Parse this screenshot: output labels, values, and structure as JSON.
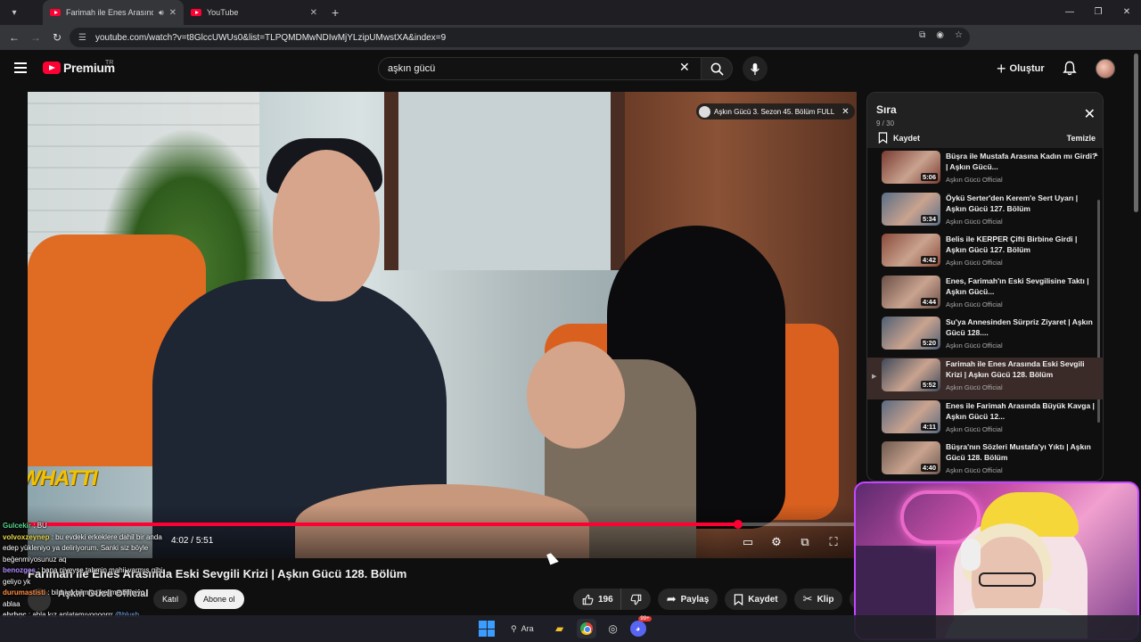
{
  "browser": {
    "tabs": [
      {
        "title": "Farimah ile Enes Arasında E",
        "active": true
      },
      {
        "title": "YouTube",
        "active": false
      }
    ],
    "url": "youtube.com/watch?v=t8GlccUWUs0&list=TLPQMDMwNDIwMjYLzipUMwstXA&index=9"
  },
  "header": {
    "logo": "Premium",
    "region": "TR",
    "search_query": "aşkın gücü",
    "create_label": "Oluştur"
  },
  "player": {
    "chip_label": "Aşkın Gücü 3. Sezon 45. Bölüm FULL",
    "time_current": "4:02",
    "time_total": "5:51",
    "progress": 0.857,
    "channel_logo_text": "WHATTI"
  },
  "video": {
    "title": "Farimah ile Enes Arasında Eski Sevgili Krizi | Aşkın Gücü 128. Bölüm",
    "channel": "Aşkın Gücü Official",
    "join_label": "Katıl",
    "subscribe_label": "Abone ol",
    "likes": "196",
    "share_label": "Paylaş",
    "save_label": "Kaydet",
    "clip_label": "Klip"
  },
  "chat": [
    {
      "user": "Gulcekir",
      "color": "green",
      "text": "BU"
    },
    {
      "user": "volvoxzeynep",
      "color": "yellow",
      "text": "bu evdeki erkeklere dahil bir anda"
    },
    {
      "user": "",
      "color": "white",
      "text": "edep yükleniyo ya deliriyorum. Sanki siz böyle"
    },
    {
      "user": "",
      "color": "white",
      "text": "beğenmiyosunuz aq"
    },
    {
      "user": "benozges",
      "color": "purple",
      "text": "bana niyeyse tahmin mahii varmış gibi"
    },
    {
      "user": "",
      "color": "white",
      "text": "geliyo yk"
    },
    {
      "user": "durumastisti",
      "color": "orange",
      "text": "bilmiyo bilmiyo kelime bilmiyo"
    },
    {
      "user": "",
      "color": "white",
      "text": "ablaa"
    },
    {
      "user": "ebrbgc",
      "color": "white",
      "text": "abla kız anlatamıyoooorrr",
      "mention": "@blush"
    }
  ],
  "queue": {
    "title": "Sıra",
    "count": "9 / 30",
    "save_label": "Kaydet",
    "clear_label": "Temizle",
    "items": [
      {
        "title": "Büşra ile Mustafa Arasına Kadın mı Girdi? | Aşkın Gücü...",
        "channel": "Aşkın Gücü Official",
        "duration": "5:06",
        "thumb_color": "#7a3b32",
        "active": false
      },
      {
        "title": "Öykü Serter'den Kerem'e Sert Uyarı | Aşkın Gücü 127. Bölüm",
        "channel": "Aşkın Gücü Official",
        "duration": "5:34",
        "thumb_color": "#5a6e86",
        "active": false
      },
      {
        "title": "Belis ile KERPER Çifti Birbine Girdi | Aşkın Gücü 127. Bölüm",
        "channel": "Aşkın Gücü Official",
        "duration": "4:42",
        "thumb_color": "#8a4a3a",
        "active": false
      },
      {
        "title": "Enes, Farimah'ın Eski Sevgilisine Taktı | Aşkın Gücü...",
        "channel": "Aşkın Gücü Official",
        "duration": "4:44",
        "thumb_color": "#6b4f47",
        "active": false
      },
      {
        "title": "Su'ya Annesinden Sürpriz Ziyaret | Aşkın Gücü 128....",
        "channel": "Aşkın Gücü Official",
        "duration": "5:20",
        "thumb_color": "#4f5f73",
        "active": false
      },
      {
        "title": "Farimah ile Enes Arasında Eski Sevgili Krizi | Aşkın Gücü 128. Bölüm",
        "channel": "Aşkın Gücü Official",
        "duration": "5:52",
        "thumb_color": "#3f4a5a",
        "active": true
      },
      {
        "title": "Enes ile Farimah Arasında Büyük Kavga | Aşkın Gücü 12...",
        "channel": "Aşkın Gücü Official",
        "duration": "4:11",
        "thumb_color": "#5a6a80",
        "active": false
      },
      {
        "title": "Büşra'nın Sözleri Mustafa'yı Yıktı | Aşkın Gücü 128. Bölüm",
        "channel": "Aşkın Gücü Official",
        "duration": "4:40",
        "thumb_color": "#6e5a4f",
        "active": false
      }
    ]
  },
  "taskbar": {
    "search_label": "Ara",
    "discord_badge": "99+"
  }
}
